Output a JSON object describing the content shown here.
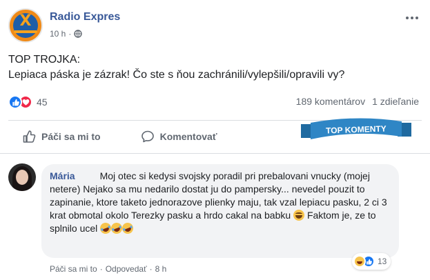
{
  "post": {
    "page_name": "Radio Expres",
    "time": "10 h",
    "dot": "·",
    "text_line1": "TOP TROJKA:",
    "text_line2": "Lepiaca páska je zázrak! Čo ste s ňou zachránili/vylepšili/opravili vy?",
    "reaction_count": "45",
    "comment_count": "189 komentárov",
    "share_count": "1 zdieľanie"
  },
  "actions": {
    "like_label": "Páči sa mi to",
    "comment_label": "Komentovať"
  },
  "banner": {
    "label": "TOP KOMENTY",
    "color": "#2f86c5"
  },
  "comment": {
    "author": "Mária",
    "text_part1": "Moj otec si kedysi svojsky poradil pri prebalovani vnucky (mojej netere) Nejako sa mu nedarilo dostat ju do pampersky... nevedel pouzit to zapinanie, ktore taketo jednorazove plienky maju, tak vzal lepiacu pasku, 2 ci 3 krat obmotal okolo Terezky pasku a hrdo cakal na babku",
    "text_part2": "Faktom je, ze to splnilo ucel",
    "reaction_count": "13",
    "like_link": "Páči sa mi to",
    "reply_link": "Odpovedať",
    "dot": "·",
    "time": "8 h"
  },
  "icons": [
    "page-logo",
    "globe-icon",
    "more-options-icon",
    "like-reaction-icon",
    "love-reaction-icon",
    "thumbs-up-icon",
    "comment-icon",
    "smile-emoji",
    "laughing-emoji",
    "haha-reaction-icon"
  ],
  "colors": {
    "link_blue": "#385898",
    "like_blue": "#1877f2",
    "love_red": "#f0284a",
    "bubble_bg": "#f2f3f5",
    "logo_orange": "#f08a17"
  }
}
